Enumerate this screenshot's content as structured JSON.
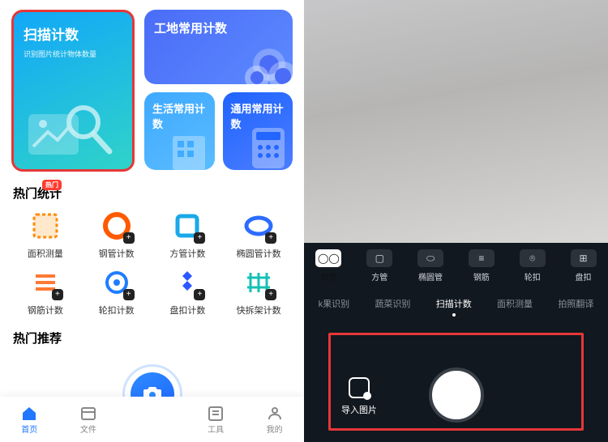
{
  "left": {
    "card_scan": {
      "title": "扫描计数",
      "subtitle": "识别图片统计物体数量"
    },
    "card_site": {
      "title": "工地常用计数"
    },
    "card_life": {
      "title": "生活常用计数"
    },
    "card_general": {
      "title": "通用常用计数"
    },
    "section_hot_stats": "热门统计",
    "badge_hot": "热门",
    "stats": [
      {
        "label": "面积测量",
        "color": "#ff8a00",
        "plus": false
      },
      {
        "label": "钢管计数",
        "color": "#ff5a00",
        "plus": true
      },
      {
        "label": "方管计数",
        "color": "#1aa9e8",
        "plus": true
      },
      {
        "label": "椭圆管计数",
        "color": "#2c6cff",
        "plus": true
      },
      {
        "label": "钢筋计数",
        "color": "#ff7a33",
        "plus": true
      },
      {
        "label": "轮扣计数",
        "color": "#1f7dff",
        "plus": true
      },
      {
        "label": "盘扣计数",
        "color": "#2b58ff",
        "plus": true
      },
      {
        "label": "快拆架计数",
        "color": "#16c0b4",
        "plus": true
      }
    ],
    "section_hot_rec": "热门推荐",
    "nav": [
      {
        "label": "首页",
        "active": true
      },
      {
        "label": "文件",
        "active": false
      },
      {
        "label": "工具",
        "active": false
      },
      {
        "label": "我的",
        "active": false
      }
    ]
  },
  "right": {
    "tools": [
      {
        "label": "钢管"
      },
      {
        "label": "方管"
      },
      {
        "label": "椭圆管"
      },
      {
        "label": "钢筋"
      },
      {
        "label": "轮扣"
      },
      {
        "label": "盘扣"
      }
    ],
    "modes": [
      {
        "label": "k果识别",
        "active": false
      },
      {
        "label": "蔬菜识别",
        "active": false
      },
      {
        "label": "扫描计数",
        "active": true
      },
      {
        "label": "面积测量",
        "active": false
      },
      {
        "label": "拍照翻译",
        "active": false
      }
    ],
    "import_label": "导入图片"
  }
}
